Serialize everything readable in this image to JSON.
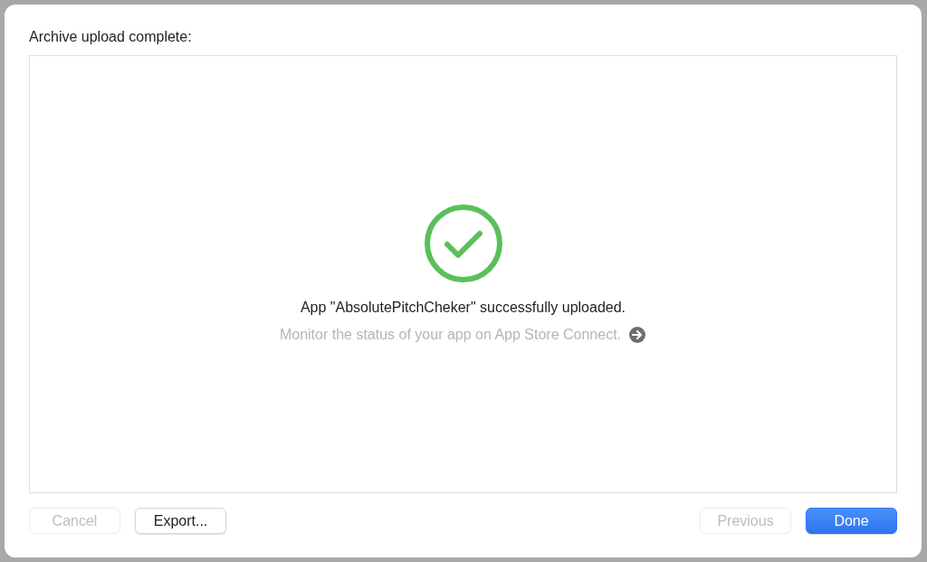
{
  "heading": "Archive upload complete:",
  "result": {
    "succeeded": true,
    "message": "App \"AbsolutePitchCheker\" successfully uploaded.",
    "link": "Monitor the status of your app on App Store Connect."
  },
  "left_buttons": [
    {
      "label": "Cancel",
      "disabled": true,
      "primary": false
    },
    {
      "label": "Export...",
      "disabled": false,
      "primary": false
    }
  ],
  "right_buttons": [
    {
      "label": "Previous",
      "disabled": true,
      "primary": false
    },
    {
      "label": "Done",
      "disabled": false,
      "primary": true
    }
  ]
}
